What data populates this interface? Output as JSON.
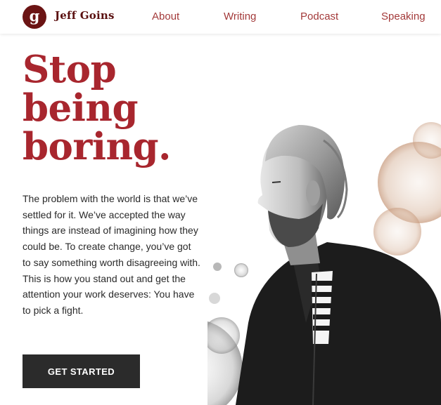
{
  "header": {
    "logo_letter": "g",
    "brand_name": "Jeff Goins",
    "nav": [
      {
        "label": "About"
      },
      {
        "label": "Writing"
      },
      {
        "label": "Podcast"
      },
      {
        "label": "Speaking"
      }
    ]
  },
  "hero": {
    "headline_lines": [
      "Stop",
      "being",
      "boring."
    ],
    "body": "The problem with the world is that we’ve settled for it. We’ve accepted the way things are instead of imagining how they could be. To create change, you’ve got to say something worth disagreeing with. This is how you stand out and get the attention your work deserves: You have to pick a fight.",
    "cta_label": "GET STARTED"
  },
  "colors": {
    "brand_dark": "#6b1414",
    "headline_red": "#a8262e",
    "nav_red": "#a33a3a",
    "cta_bg": "#2b2b2b"
  }
}
